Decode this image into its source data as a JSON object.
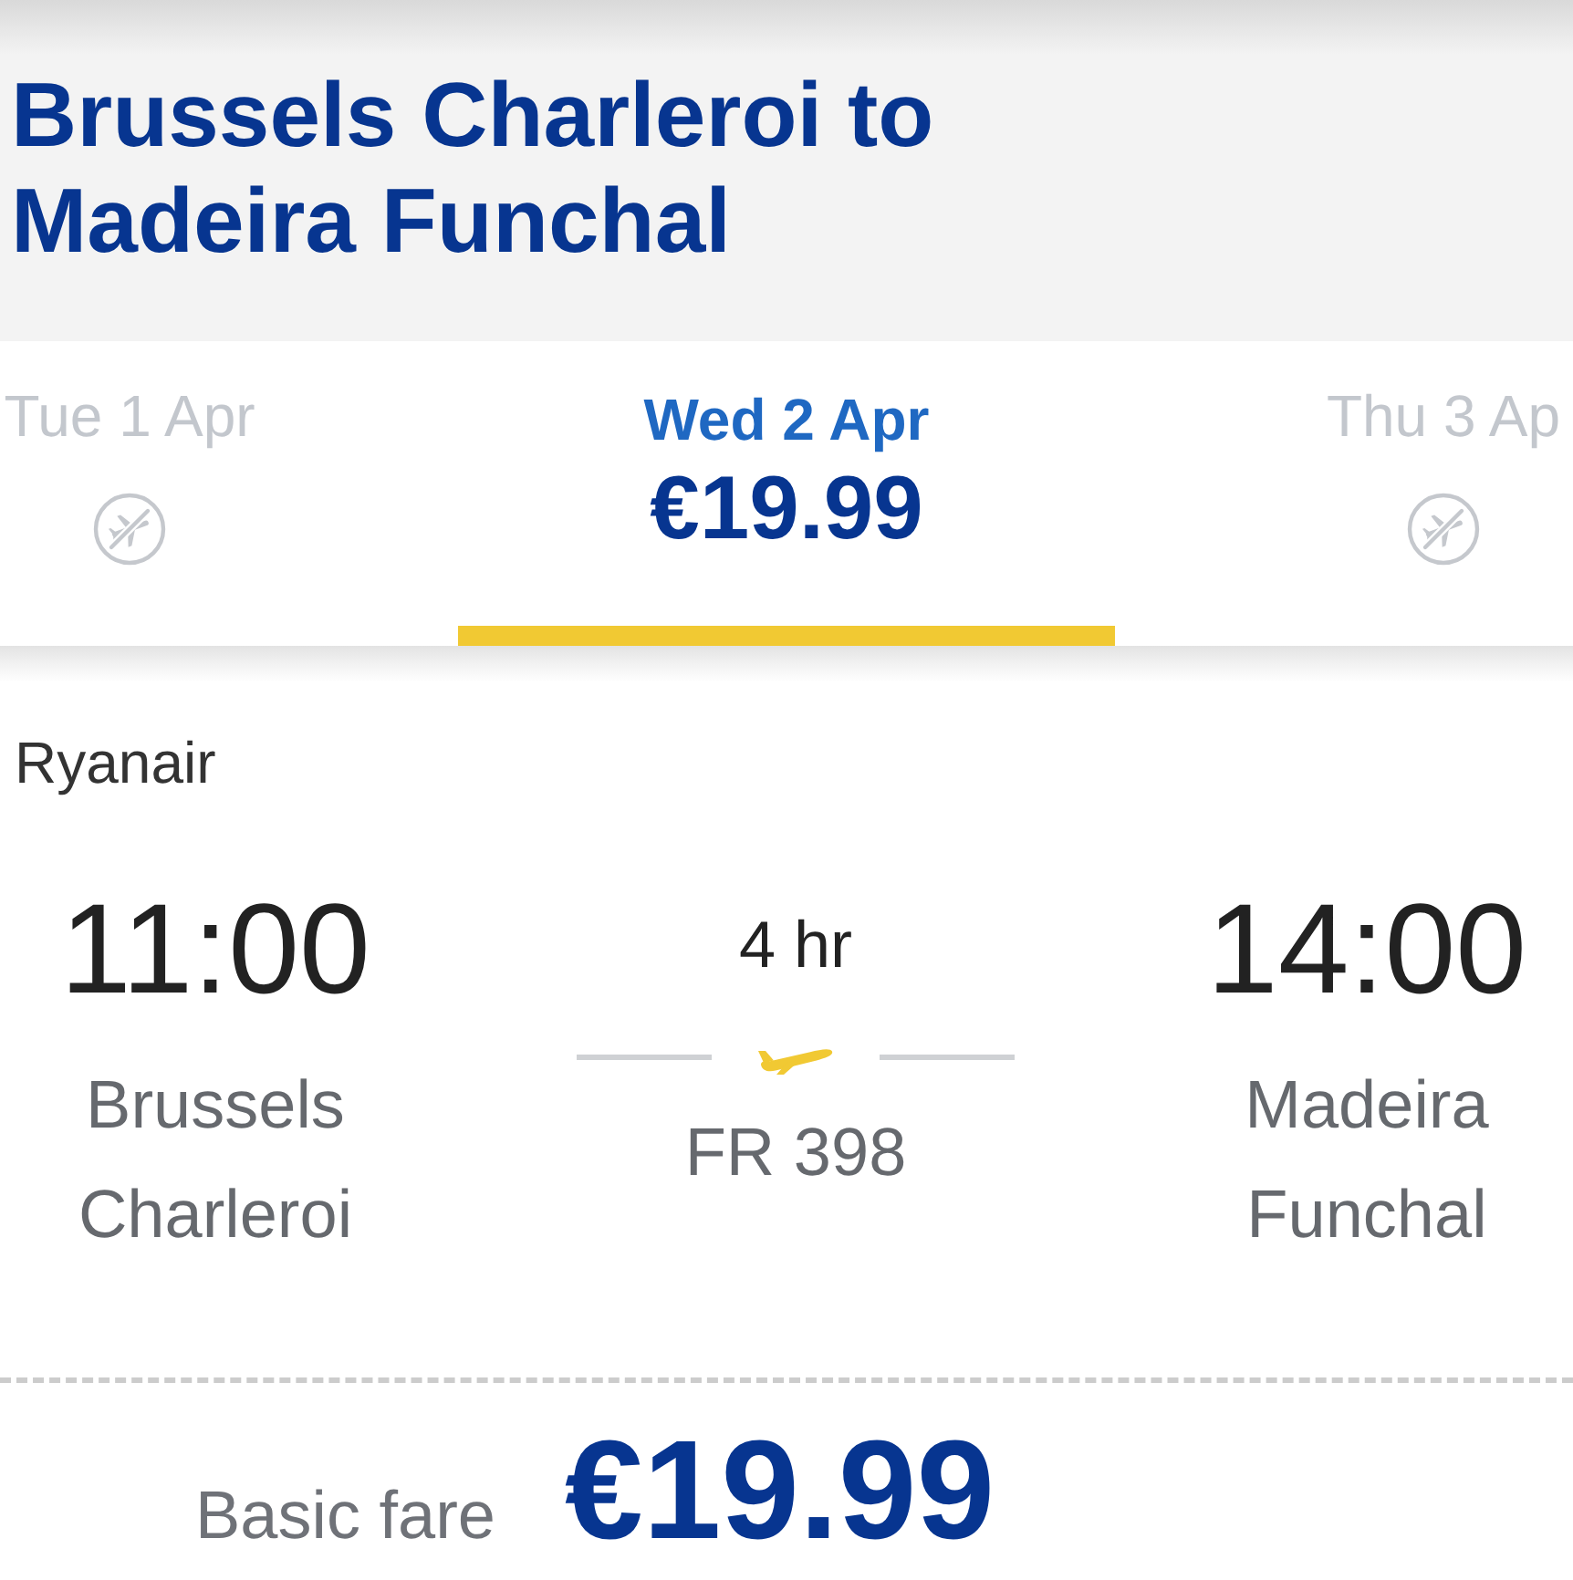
{
  "header": {
    "title": "Brussels Charleroi to Madeira Funchal"
  },
  "date_tabs": [
    {
      "label": "Tue 1 Apr",
      "selected": false,
      "available": false
    },
    {
      "label": "Wed 2 Apr",
      "selected": true,
      "available": true,
      "price": "€19.99"
    },
    {
      "label": "Thu 3 Ap",
      "selected": false,
      "available": false
    }
  ],
  "flight": {
    "airline": "Ryanair",
    "departure": {
      "time": "11:00",
      "airport": "Brussels Charleroi"
    },
    "duration": "4 hr",
    "flight_number": "FR 398",
    "arrival": {
      "time": "14:00",
      "airport": "Madeira Funchal"
    }
  },
  "fare": {
    "label": "Basic fare",
    "price": "€19.99"
  }
}
